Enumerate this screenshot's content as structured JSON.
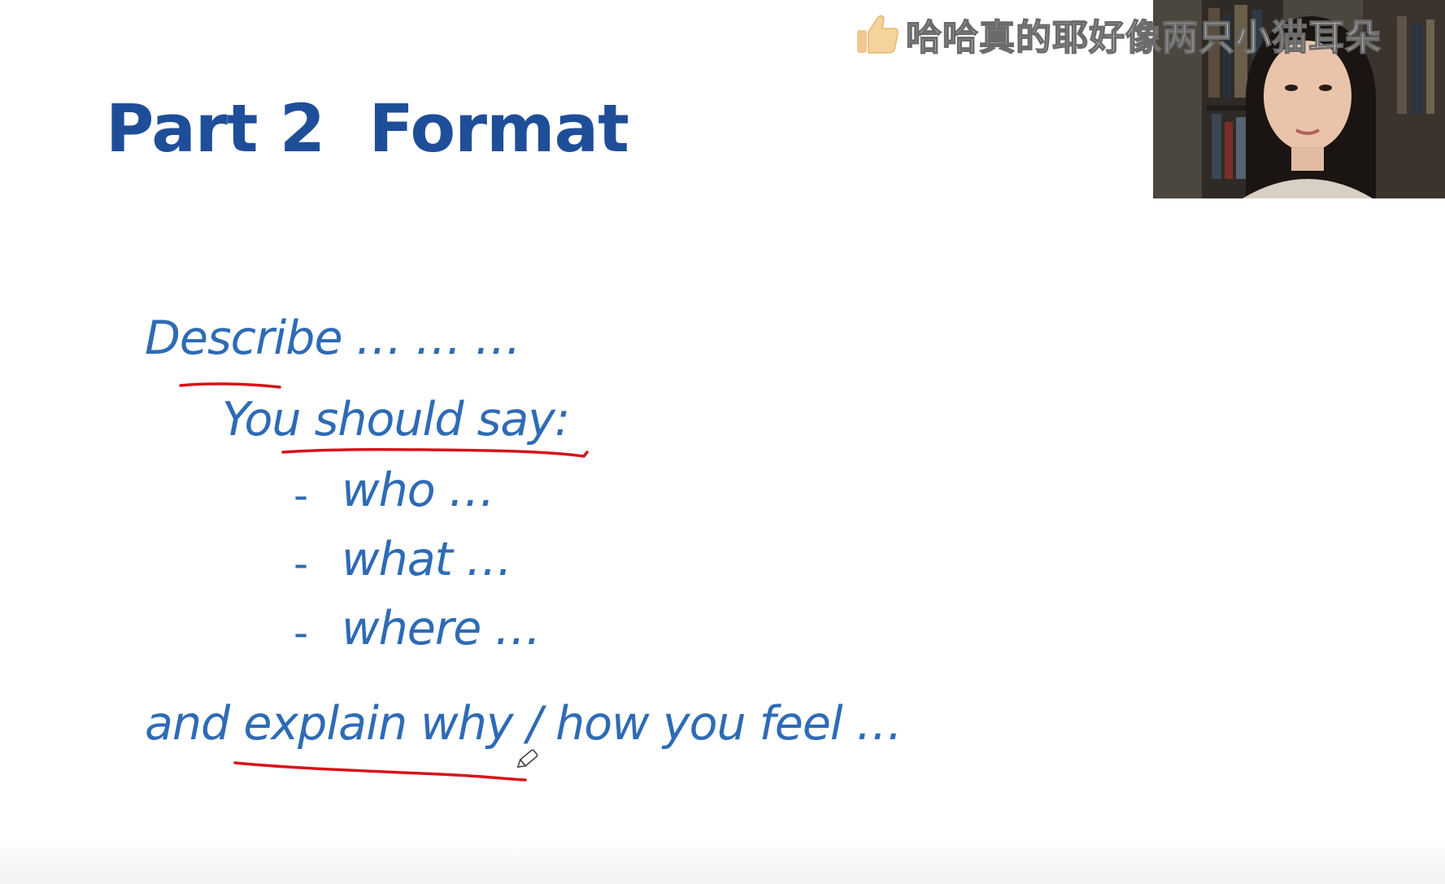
{
  "slide": {
    "title": "Part 2  Format",
    "lines": {
      "describe": "Describe … … …",
      "you_should_say": "You should say:",
      "bullet_dash": "-",
      "bullet_who": "who …",
      "bullet_what": "what …",
      "bullet_where": "where …",
      "explain": "and explain why / how you feel …"
    }
  },
  "overlay_comment": {
    "icon": "thumbs-up-icon",
    "text": "哈哈真的耶好像两只小猫耳朵"
  },
  "colors": {
    "title": "#1f4e99",
    "body": "#2e6bb5",
    "annotation_ink": "#d8121a"
  }
}
